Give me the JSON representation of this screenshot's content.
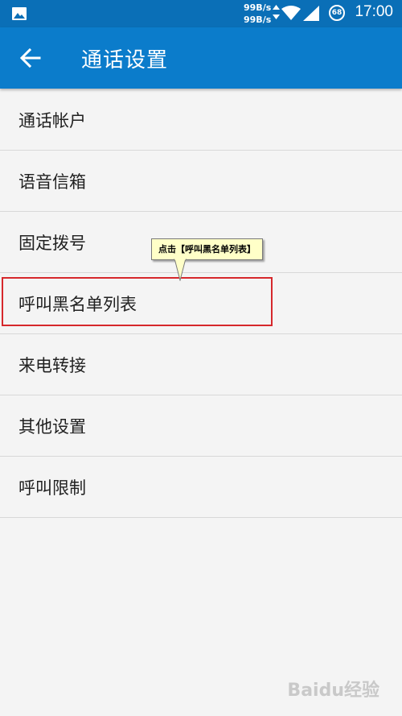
{
  "status_bar": {
    "net_up": "99B/s",
    "net_down": "99B/s",
    "battery": "68",
    "time": "17:00",
    "icons": [
      "gallery-icon",
      "wifi-icon",
      "signal-icon",
      "battery-icon"
    ]
  },
  "app_bar": {
    "title": "通话设置",
    "background": "#0b7ccb",
    "status_background": "#0a6fb7"
  },
  "settings": {
    "items": [
      {
        "label": "通话帐户"
      },
      {
        "label": "语音信箱"
      },
      {
        "label": "固定拨号"
      },
      {
        "label": "呼叫黑名单列表"
      },
      {
        "label": "来电转接"
      },
      {
        "label": "其他设置"
      },
      {
        "label": "呼叫限制"
      }
    ]
  },
  "annotation": {
    "callout_text": "点击【呼叫黑名单列表】",
    "highlight_color": "#d6282c"
  },
  "watermark": {
    "text": "Baidu经验"
  }
}
